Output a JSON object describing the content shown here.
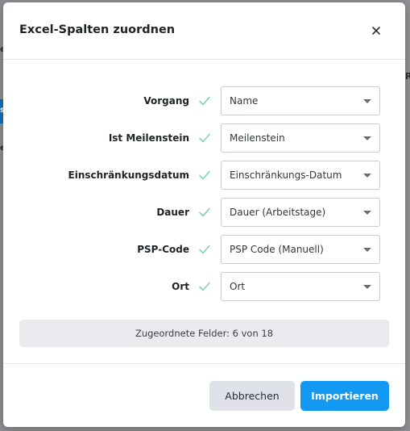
{
  "background": {
    "fragments": [
      "e",
      "s",
      "e",
      "R"
    ]
  },
  "dialog": {
    "title": "Excel-Spalten zuordnen",
    "close_icon": "close-icon"
  },
  "mappings": [
    {
      "label": "Vorgang",
      "value": "Name"
    },
    {
      "label": "Ist Meilenstein",
      "value": "Meilenstein"
    },
    {
      "label": "Einschränkungsdatum",
      "value": "Einschränkungs-Datum"
    },
    {
      "label": "Dauer",
      "value": "Dauer (Arbeitstage)"
    },
    {
      "label": "PSP-Code",
      "value": "PSP Code (Manuell)"
    },
    {
      "label": "Ort",
      "value": "Ort"
    }
  ],
  "status": {
    "text": "Zugeordnete Felder: 6 von 18"
  },
  "footer": {
    "cancel_label": "Abbrechen",
    "import_label": "Importieren"
  },
  "colors": {
    "check": "#7fd3bd",
    "primary": "#1499f2"
  }
}
